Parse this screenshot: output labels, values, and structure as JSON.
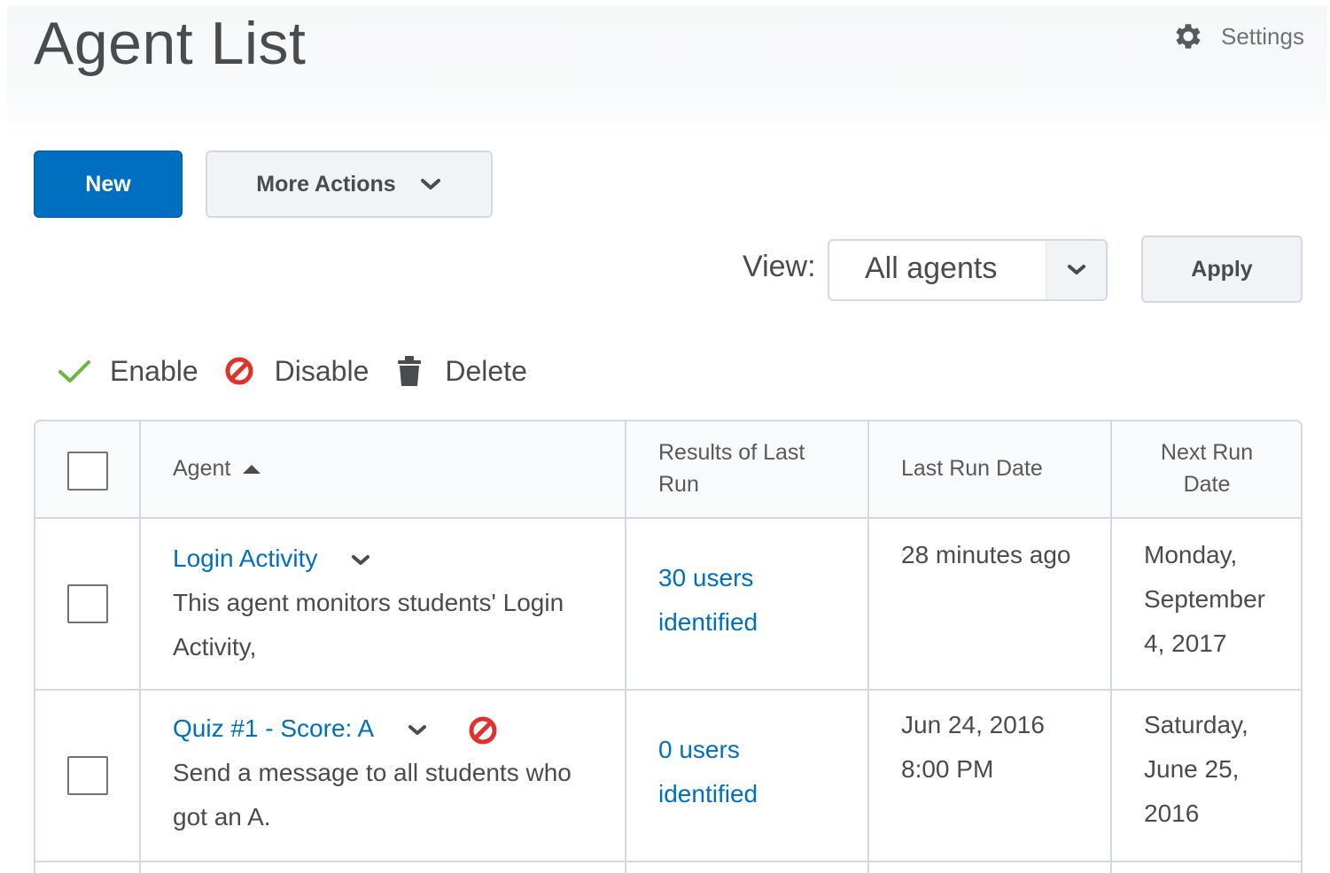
{
  "header": {
    "title": "Agent List",
    "settings_label": "Settings"
  },
  "toolbar": {
    "new_label": "New",
    "more_actions_label": "More Actions"
  },
  "filter": {
    "view_label": "View:",
    "selected_view": "All agents",
    "apply_label": "Apply"
  },
  "bulk_actions": {
    "enable_label": "Enable",
    "disable_label": "Disable",
    "delete_label": "Delete"
  },
  "table": {
    "columns": {
      "agent": "Agent",
      "results_line1": "Results of Last",
      "results_line2": "Run",
      "last_run": "Last Run Date",
      "next_run_line1": "Next Run",
      "next_run_line2": "Date"
    },
    "rows": [
      {
        "name": "Login Activity",
        "disabled": false,
        "desc_line1": "This agent monitors students' Login",
        "desc_line2": "Activity,",
        "results_line1": "30 users",
        "results_line2": "identified",
        "last_run_line1": "28 minutes ago",
        "last_run_line2": "",
        "next_run_line1": "Monday,",
        "next_run_line2": "September",
        "next_run_line3": "4, 2017"
      },
      {
        "name": "Quiz #1 - Score: A",
        "disabled": true,
        "desc_line1": "Send a message to all students who",
        "desc_line2": "got an A.",
        "results_line1": "0 users",
        "results_line2": "identified",
        "last_run_line1": "Jun 24, 2016",
        "last_run_line2": "8:00 PM",
        "next_run_line1": "Saturday,",
        "next_run_line2": "June 25,",
        "next_run_line3": "2016"
      }
    ]
  },
  "colors": {
    "primary": "#006fbf",
    "text": "#494c4e",
    "border": "#d3d9e3",
    "enable_green": "#6cb33f",
    "disable_red": "#e0312a"
  },
  "icons": {
    "settings": "gear-icon",
    "more_actions": "chevron-down-icon",
    "enable": "checkmark-icon",
    "disable": "no-entry-icon",
    "delete": "trash-icon",
    "sort": "sort-ascending-icon"
  }
}
